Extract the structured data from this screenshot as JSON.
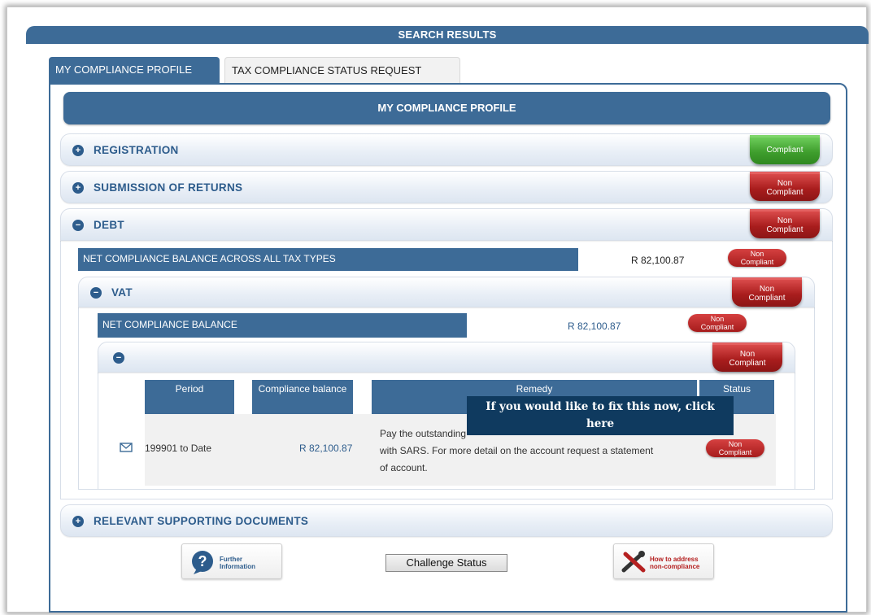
{
  "header": {
    "title": "SEARCH RESULTS"
  },
  "tabs": [
    {
      "label": "MY COMPLIANCE PROFILE",
      "active": true
    },
    {
      "label": "TAX COMPLIANCE STATUS REQUEST",
      "active": false
    }
  ],
  "profile": {
    "heading": "MY COMPLIANCE PROFILE"
  },
  "sections": {
    "registration": {
      "title": "REGISTRATION",
      "status": "Compliant"
    },
    "submission": {
      "title": "SUBMISSION OF RETURNS",
      "status_line1": "Non",
      "status_line2": "Compliant"
    },
    "debt": {
      "title": "DEBT",
      "status_line1": "Non",
      "status_line2": "Compliant"
    },
    "documents": {
      "title": "RELEVANT SUPPORTING DOCUMENTS"
    }
  },
  "debt": {
    "net_label": "NET COMPLIANCE BALANCE ACROSS ALL TAX TYPES",
    "net_amount": "R  82,100.87",
    "net_status_line1": "Non",
    "net_status_line2": "Compliant",
    "vat": {
      "title": "VAT",
      "status_line1": "Non",
      "status_line2": "Compliant",
      "net_label": "NET COMPLIANCE BALANCE",
      "net_amount": "R  82,100.87",
      "net_status_line1": "Non",
      "net_status_line2": "Compliant",
      "inner_status_line1": "Non",
      "inner_status_line2": "Compliant",
      "table": {
        "headers": [
          "Period",
          "Compliance balance",
          "Remedy",
          "Status"
        ],
        "row": {
          "period": "199901 to Date",
          "balance": "R  82,100.87",
          "remedy_line1": "Pay the outstanding",
          "remedy_line2": "with SARS. For more detail on the account request a statement",
          "remedy_line3": "of account.",
          "status_line1": "Non",
          "status_line2": "Compliant"
        }
      }
    }
  },
  "tooltip": {
    "line1": "If you would like to fix this now, click",
    "line2": "here"
  },
  "buttons": {
    "further_info_line1": "Further",
    "further_info_line2": "Information",
    "challenge": "Challenge Status",
    "howto_line1": "How to address",
    "howto_line2": "non-compliance"
  },
  "icons": {
    "further_info": "question-bubble-icon",
    "howto": "tools-icon",
    "row": "envelope-icon"
  },
  "colors": {
    "primary_blue": "#3d6b97",
    "compliant_green": "#3f9e2d",
    "non_compliant_red": "#a91d1d"
  }
}
